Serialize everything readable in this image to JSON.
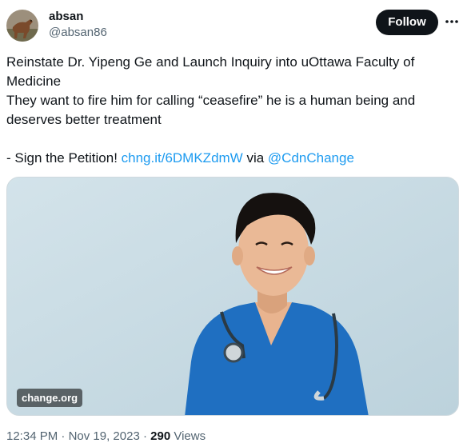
{
  "author": {
    "display_name": "absan",
    "handle": "@absan86",
    "avatar_icon": "horse-avatar-photo"
  },
  "actions": {
    "follow_label": "Follow",
    "more_icon": "more-horizontal-icon"
  },
  "tweet": {
    "lines": [
      "Reinstate Dr. Yipeng Ge and Launch Inquiry into uOttawa Faculty of",
      "Medicine",
      "They want to fire him for calling “ceasefire” he is a human being and",
      "deserves better treatment"
    ],
    "petition_prefix": "- Sign the Petition! ",
    "petition_link": "chng.it/6DMKZdmW",
    "via_text": " via ",
    "mention": "@CdnChange"
  },
  "media": {
    "watermark": "change.org",
    "photo_subject": "doctor-portrait-photo"
  },
  "meta": {
    "time": "12:34 PM",
    "separator": " · ",
    "date": "Nov 19, 2023",
    "views_count": "290",
    "views_label": " Views"
  },
  "colors": {
    "link": "#1d9bf0",
    "text": "#0f1419",
    "secondary": "#536471",
    "follow_bg": "#0f1419",
    "scrubs": "#1f6fc1",
    "photo_bg": "#c9dce4"
  }
}
